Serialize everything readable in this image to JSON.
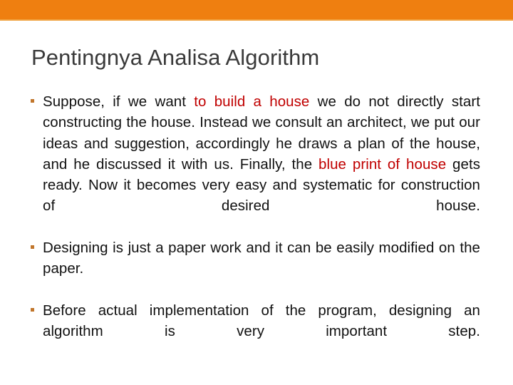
{
  "slide": {
    "title": "Pentingnya Analisa Algorithm",
    "accent_color": "#ef7f10",
    "accent_edge_color": "#f0a13f",
    "title_color": "#3a3a3a",
    "body_color": "#111111",
    "highlight_color": "#c00000",
    "bullet_color": "#c1762c"
  },
  "bullets": [
    {
      "bullet_glyph": "square-bullet",
      "segments": [
        {
          "text": "Suppose, if we want ",
          "style": "normal"
        },
        {
          "text": "to build a house",
          "style": "highlight"
        },
        {
          "text": " we do not directly start constructing the house. Instead we consult an architect, we put our ideas and suggestion, accordingly he draws a plan of the house, and he discussed it with us. Finally, the ",
          "style": "normal"
        },
        {
          "text": "blue print of house",
          "style": "highlight"
        },
        {
          "text": " gets ready. Now it becomes very easy and systematic for construction of desired house.",
          "style": "normal"
        }
      ]
    },
    {
      "bullet_glyph": "square-bullet",
      "segments": [
        {
          "text": "Designing is just a paper work and it can be easily modified on the paper.",
          "style": "normal"
        }
      ]
    },
    {
      "bullet_glyph": "square-bullet",
      "segments": [
        {
          "text": "Before actual implementation of the program, designing an algorithm is very important step.",
          "style": "normal"
        }
      ]
    }
  ]
}
